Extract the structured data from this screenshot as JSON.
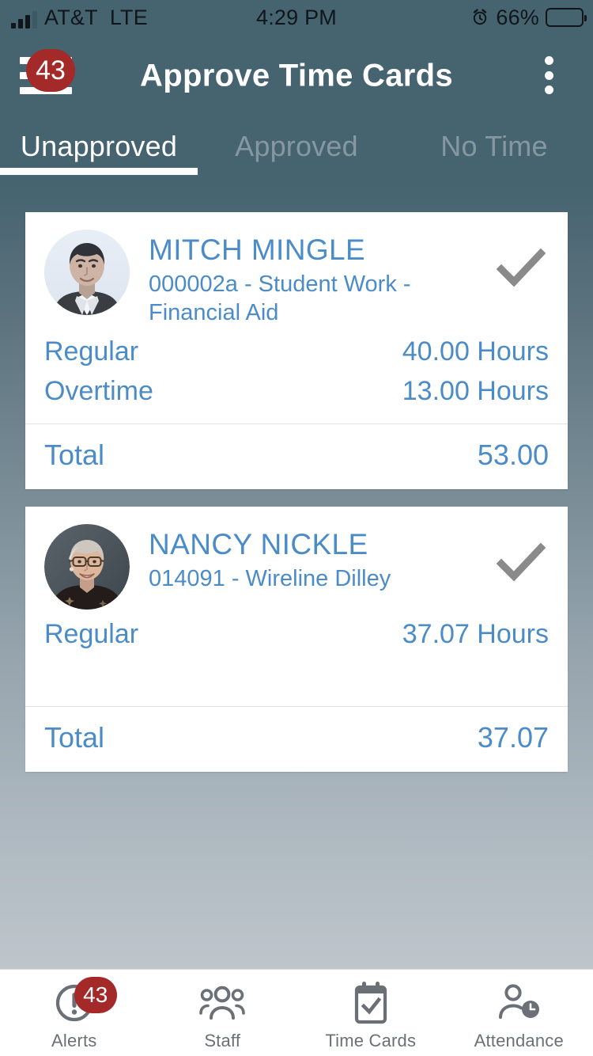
{
  "status_bar": {
    "carrier": "AT&T",
    "network": "LTE",
    "time": "4:29 PM",
    "battery_percent": "66%",
    "battery_level": 66,
    "alarm_icon": "alarm-clock-icon",
    "signal_icon": "signal-bars-icon"
  },
  "app_bar": {
    "title": "Approve Time Cards",
    "menu_icon": "hamburger-menu-icon",
    "menu_badge": "43",
    "overflow_icon": "overflow-menu-icon",
    "background_color": "#466370"
  },
  "tabs": {
    "items": [
      {
        "label": "Unapproved",
        "active": true
      },
      {
        "label": "Approved",
        "active": false
      },
      {
        "label": "No Time",
        "active": false
      }
    ]
  },
  "colors": {
    "accent_blue": "#4b8cc8",
    "badge_red": "#a32a28",
    "header_teal": "#466370",
    "check_gray": "#8a8a8a"
  },
  "cards": [
    {
      "name": "MITCH MINGLE",
      "subtitle": "000002a - Student Work - Financial Aid",
      "avatar": "photo-male-avatar",
      "check_icon": "checkmark-icon",
      "rows": [
        {
          "label": "Regular",
          "value": "40.00 Hours"
        },
        {
          "label": "Overtime",
          "value": "13.00 Hours"
        }
      ],
      "total_label": "Total",
      "total_value": "53.00"
    },
    {
      "name": "NANCY NICKLE",
      "subtitle": "014091 - Wireline Dilley",
      "avatar": "photo-female-avatar",
      "check_icon": "checkmark-icon",
      "rows": [
        {
          "label": "Regular",
          "value": "37.07 Hours"
        }
      ],
      "total_label": "Total",
      "total_value": "37.07"
    }
  ],
  "bottom_nav": {
    "items": [
      {
        "label": "Alerts",
        "icon": "alert-exclamation-icon",
        "badge": "43"
      },
      {
        "label": "Staff",
        "icon": "people-group-icon",
        "badge": ""
      },
      {
        "label": "Time Cards",
        "icon": "calendar-check-icon",
        "badge": ""
      },
      {
        "label": "Attendance",
        "icon": "person-clock-icon",
        "badge": ""
      }
    ]
  }
}
